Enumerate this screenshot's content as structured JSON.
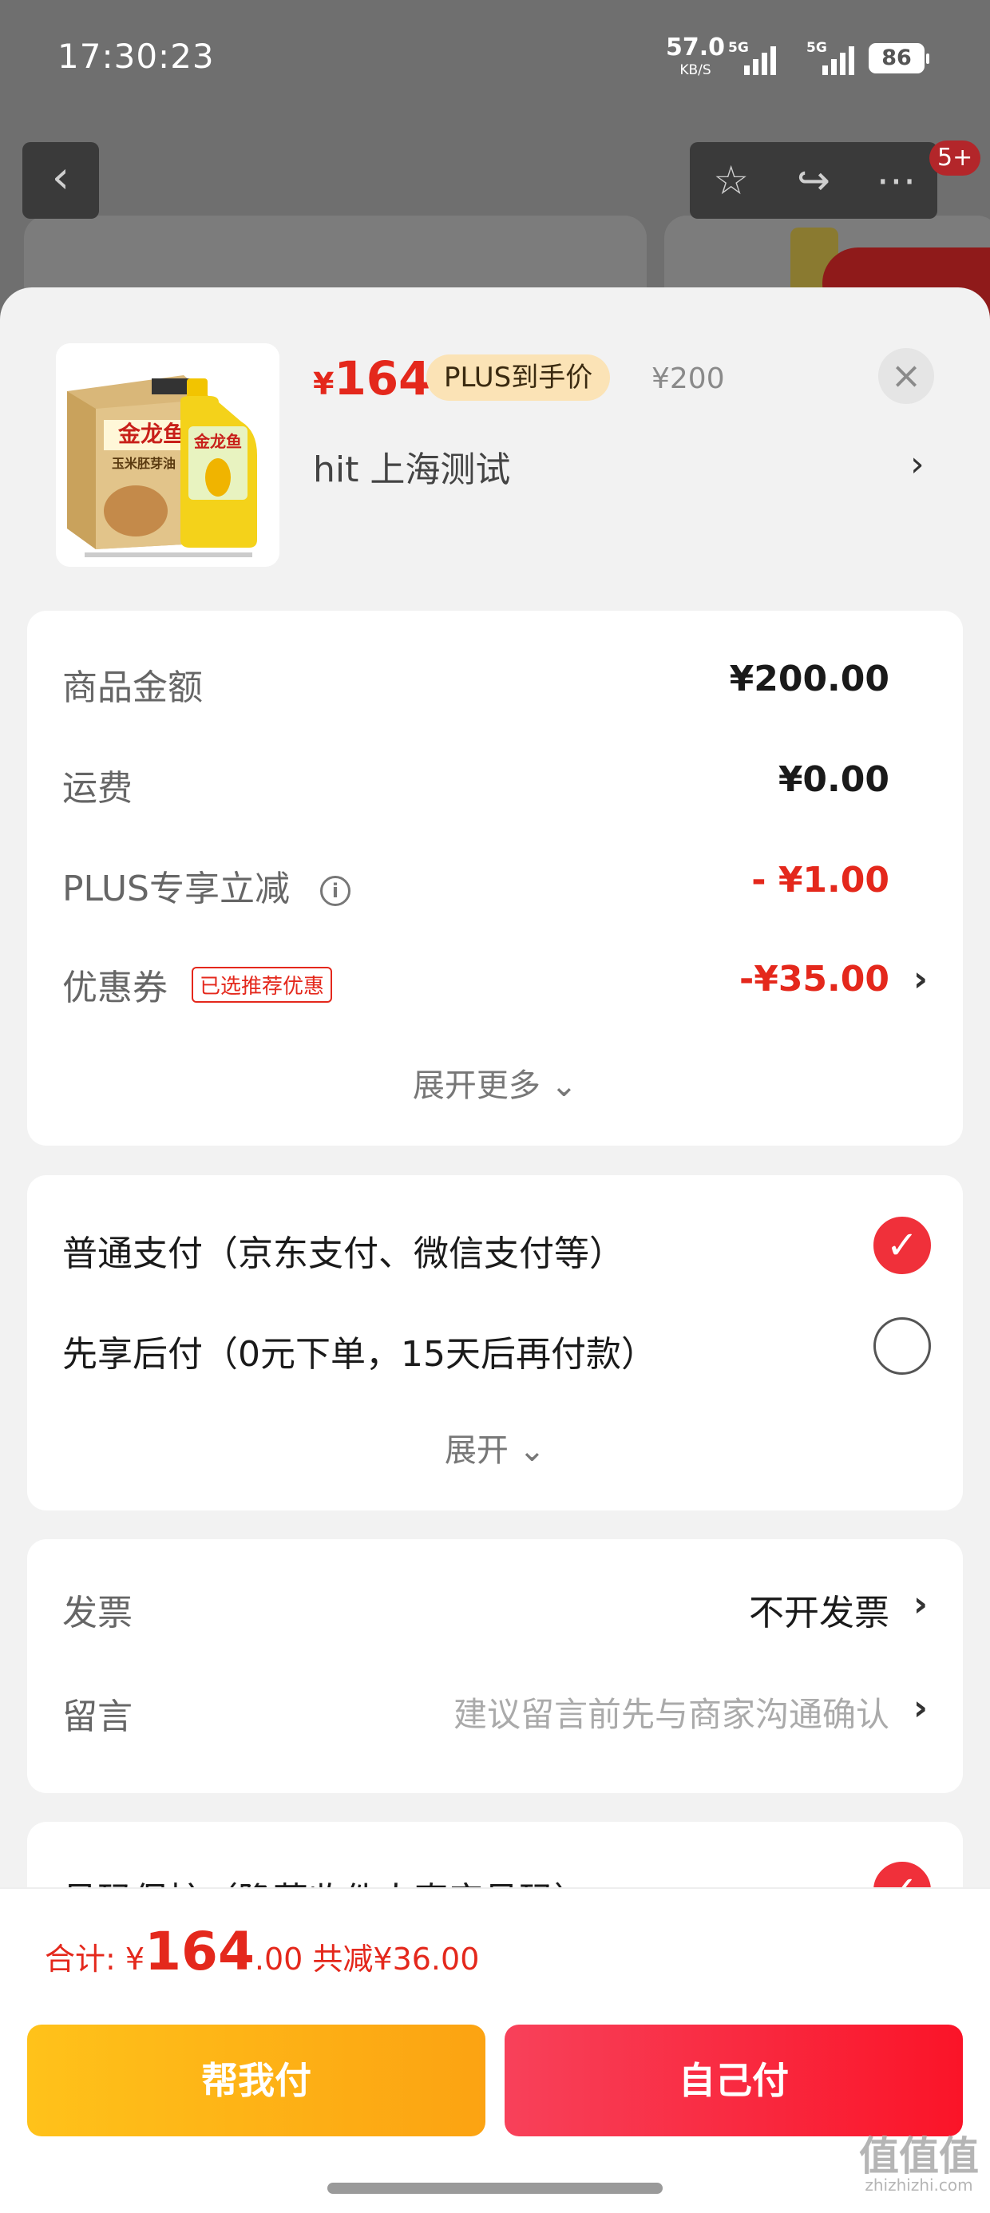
{
  "status_bar": {
    "time": "17:30:23",
    "speed": "57.0",
    "speed_unit": "KB/S",
    "signal1": "5G",
    "signal2": "5G",
    "battery": "86"
  },
  "nav": {
    "back_icon": "chevron-left-icon",
    "badge": "5+"
  },
  "product": {
    "price_symbol": "¥",
    "price": "164",
    "plus_tag": "PLUS到手价",
    "original_price": "¥200",
    "spec": "hit 上海测试",
    "brand_text": "金龙鱼",
    "sub_text": "玉米胚芽油"
  },
  "summary": {
    "goods_label": "商品金额",
    "goods_value": "¥200.00",
    "shipping_label": "运费",
    "shipping_value": "¥0.00",
    "plus_label": "PLUS专享立减",
    "plus_value": "- ¥1.00",
    "coupon_label": "优惠券",
    "coupon_tag": "已选推荐优惠",
    "coupon_value": "-¥35.00",
    "expand_more": "展开更多"
  },
  "payment": {
    "option1": "普通支付（京东支付、微信支付等）",
    "option2": "先享后付（0元下单，15天后再付款）",
    "expand": "展开",
    "selected_index": 0
  },
  "invoice": {
    "invoice_label": "发票",
    "invoice_value": "不开发票",
    "message_label": "留言",
    "message_placeholder": "建议留言前先与商家沟通确认"
  },
  "privacy": {
    "label": "号码保护（隐藏收件人真实号码）"
  },
  "footer": {
    "total_label": "合计:",
    "total_symbol": "¥",
    "total_int": "164",
    "total_dec": ".00",
    "saved": "共减¥36.00",
    "help_pay": "帮我付",
    "self_pay": "自己付"
  },
  "watermark": {
    "text": "值值值",
    "url": "zhizhizhi.com"
  },
  "colors": {
    "accent_red": "#e4281c",
    "plus_gold": "#fbe3b6",
    "help_btn": "#ffb81a",
    "self_btn": "#fa2a3a"
  }
}
